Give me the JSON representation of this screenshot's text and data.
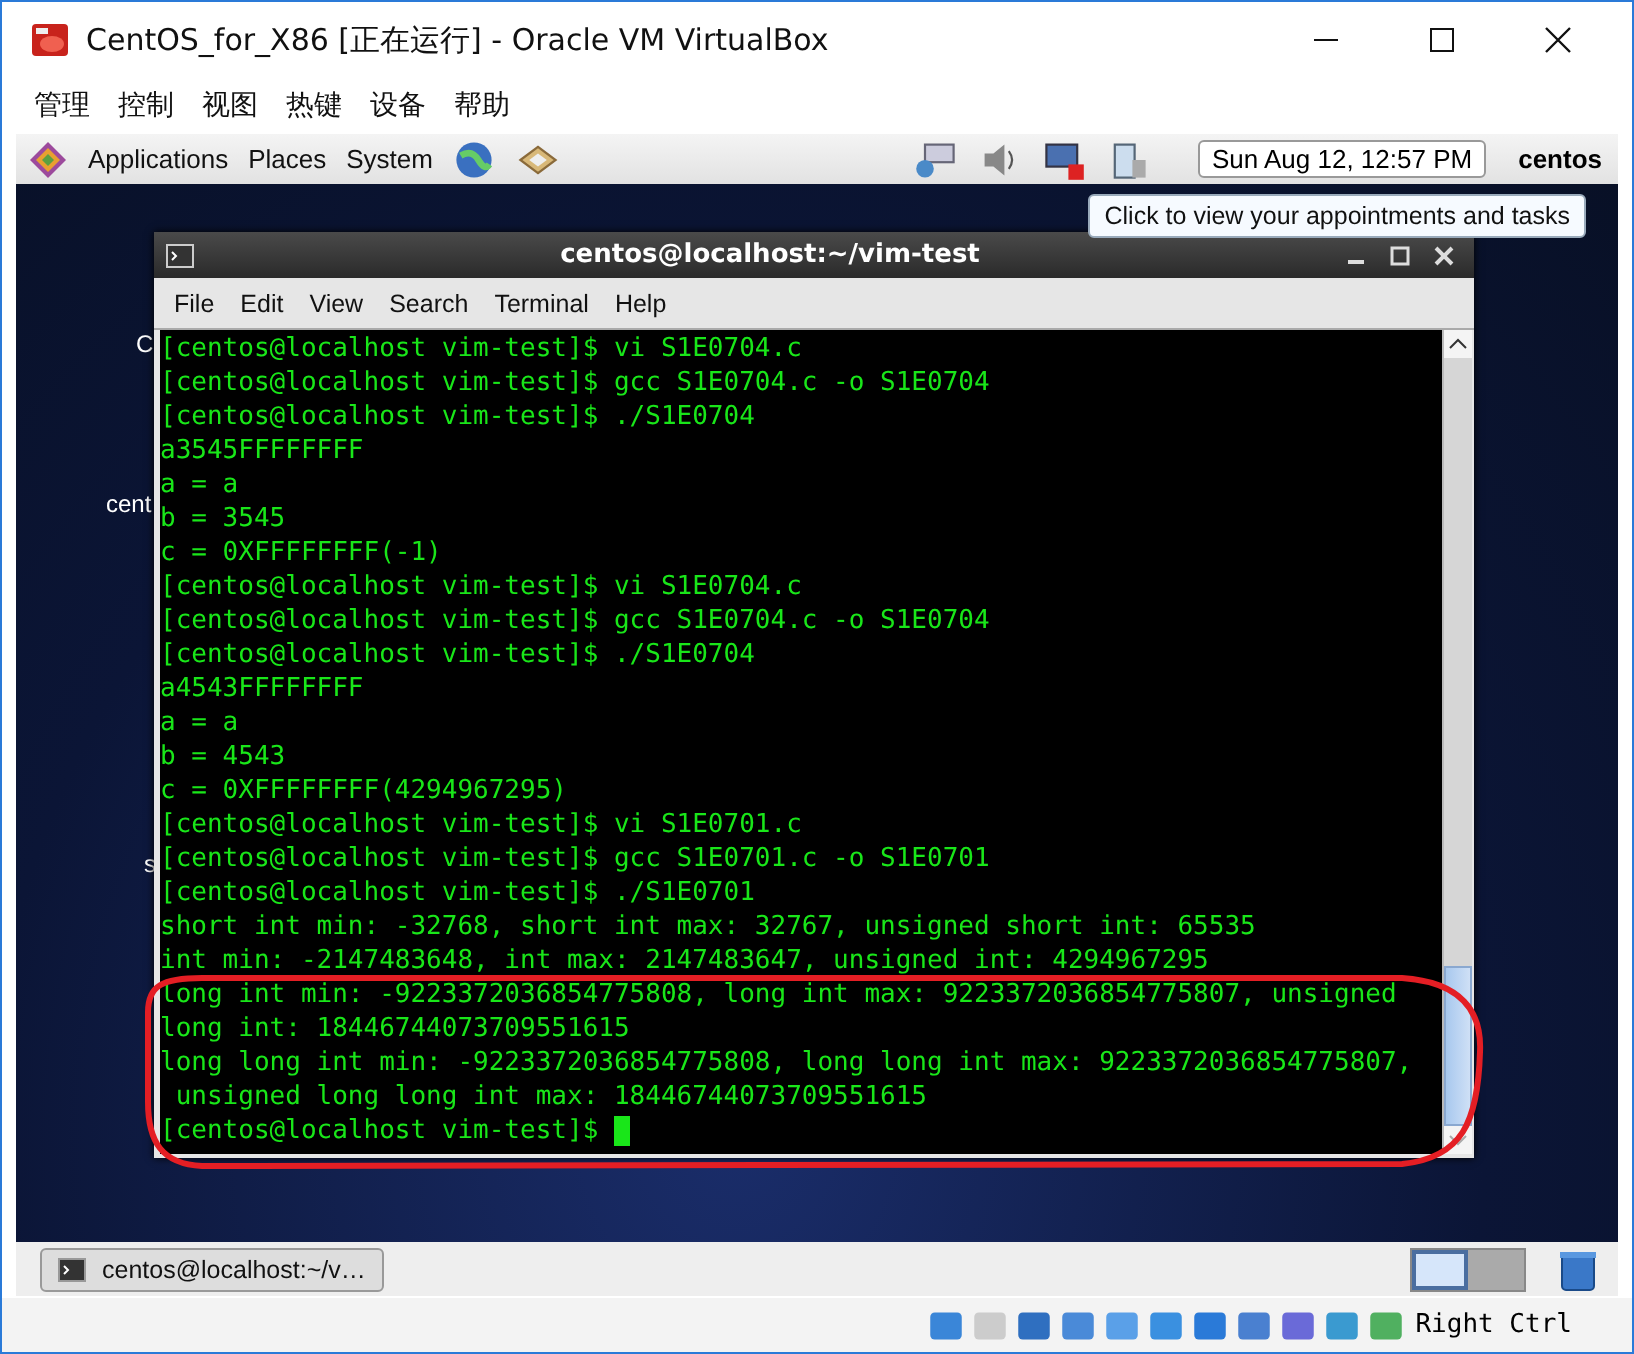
{
  "window": {
    "title": "CentOS_for_X86 [正在运行] - Oracle VM VirtualBox"
  },
  "menu": [
    "管理",
    "控制",
    "视图",
    "热键",
    "设备",
    "帮助"
  ],
  "panel": {
    "menus": [
      "Applications",
      "Places",
      "System"
    ],
    "clock": "Sun Aug 12, 12:57 PM",
    "user": "centos"
  },
  "tooltip": "Click to view your appointments and tasks",
  "desktop_labels": [
    "C",
    "cent",
    "s"
  ],
  "terminal": {
    "title": "centos@localhost:~/vim-test",
    "menu": [
      "File",
      "Edit",
      "View",
      "Search",
      "Terminal",
      "Help"
    ],
    "lines": [
      "[centos@localhost vim-test]$ vi S1E0704.c",
      "[centos@localhost vim-test]$ gcc S1E0704.c -o S1E0704",
      "[centos@localhost vim-test]$ ./S1E0704",
      "a3545FFFFFFFF",
      "a = a",
      "b = 3545",
      "c = 0XFFFFFFFF(-1)",
      "[centos@localhost vim-test]$ vi S1E0704.c",
      "[centos@localhost vim-test]$ gcc S1E0704.c -o S1E0704",
      "[centos@localhost vim-test]$ ./S1E0704",
      "a4543FFFFFFFF",
      "a = a",
      "b = 4543",
      "c = 0XFFFFFFFF(4294967295)",
      "[centos@localhost vim-test]$ vi S1E0701.c",
      "[centos@localhost vim-test]$ gcc S1E0701.c -o S1E0701",
      "[centos@localhost vim-test]$ ./S1E0701",
      "short int min: -32768, short int max: 32767, unsigned short int: 65535",
      "int min: -2147483648, int max: 2147483647, unsigned int: 4294967295",
      "long int min: -9223372036854775808, long int max: 9223372036854775807, unsigned",
      "long int: 18446744073709551615",
      "long long int min: -9223372036854775808, long long int max: 9223372036854775807,",
      " unsigned long long int max: 18446744073709551615",
      "[centos@localhost vim-test]$ "
    ]
  },
  "taskbar": {
    "tasks": [
      {
        "label": "centos@localhost:~/v…",
        "selected": false
      }
    ],
    "workspaces": [
      {
        "selected": true
      },
      {
        "selected": false
      }
    ]
  },
  "status_bar": {
    "host_key": "Right Ctrl"
  }
}
